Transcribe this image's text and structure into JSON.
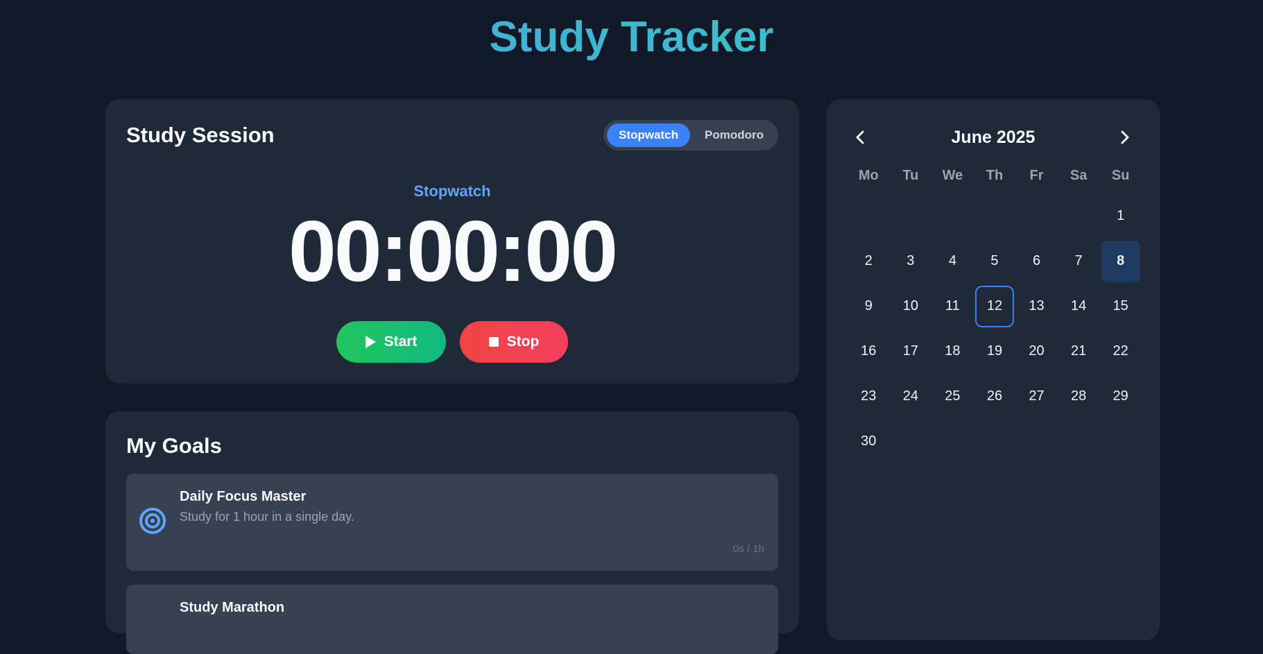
{
  "app": {
    "title": "Study Tracker"
  },
  "session": {
    "title": "Study Session",
    "modes": [
      "Stopwatch",
      "Pomodoro"
    ],
    "active_mode": "Stopwatch",
    "timer_label": "Stopwatch",
    "timer_value": "00:00:00",
    "start_label": "Start",
    "stop_label": "Stop"
  },
  "goals": {
    "title": "My Goals",
    "items": [
      {
        "name": "Daily Focus Master",
        "description": "Study for 1 hour in a single day.",
        "progress": "0s / 1h",
        "icon": "target-icon"
      },
      {
        "name": "Study Marathon",
        "description": "",
        "progress": "",
        "icon": ""
      }
    ]
  },
  "calendar": {
    "month_label": "June 2025",
    "weekdays": [
      "Mo",
      "Tu",
      "We",
      "Th",
      "Fr",
      "Sa",
      "Su"
    ],
    "weeks": [
      [
        "",
        "",
        "",
        "",
        "",
        "",
        "1"
      ],
      [
        "2",
        "3",
        "4",
        "5",
        "6",
        "7",
        "8"
      ],
      [
        "9",
        "10",
        "11",
        "12",
        "13",
        "14",
        "15"
      ],
      [
        "16",
        "17",
        "18",
        "19",
        "20",
        "21",
        "22"
      ],
      [
        "23",
        "24",
        "25",
        "26",
        "27",
        "28",
        "29"
      ],
      [
        "30",
        "",
        "",
        "",
        "",
        "",
        ""
      ]
    ],
    "today": "8",
    "selected": "12"
  },
  "colors": {
    "background": "#111827",
    "card": "#1f2937",
    "accent": "#3b82f6",
    "start": "#22c55e",
    "stop": "#ef4444"
  }
}
